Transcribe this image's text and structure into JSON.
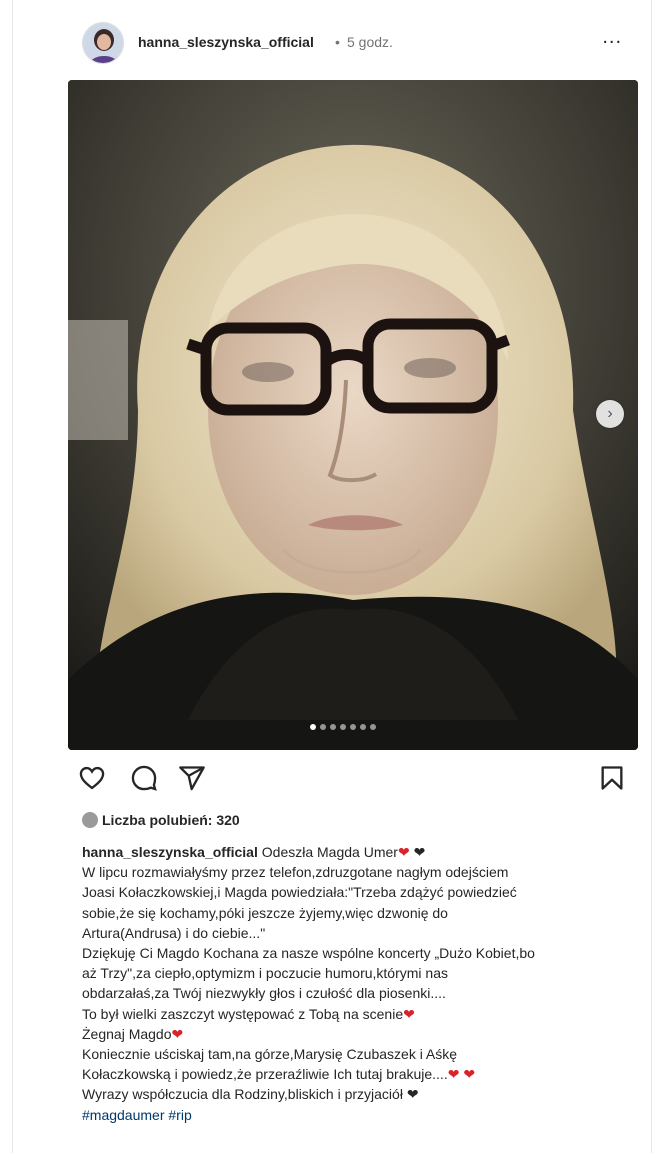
{
  "post": {
    "username": "hanna_sleszynska_official",
    "separator": "•",
    "time": "5 godz.",
    "more_label": "...",
    "carousel": {
      "current": 1,
      "total": 7,
      "next_label": "›"
    }
  },
  "likes": {
    "label": "Liczba polubień: 320"
  },
  "caption": {
    "username": "hanna_sleszynska_official",
    "first_text": "Odeszła Magda Umer",
    "lines": [
      "W lipcu rozmawiałyśmy przez telefon,zdruzgotane nagłym odejściem",
      "Joasi Kołaczkowskiej,i Magda powiedziała:\"Trzeba zdążyć powiedzieć",
      "sobie,że się kochamy,póki jeszcze żyjemy,więc dzwonię do",
      "Artura(Andrusa) i do ciebie...\"",
      "Dziękuję Ci Magdo Kochana za nasze wspólne koncerty „Dużo Kobiet,bo",
      "aż Trzy\",za ciepło,optymizm i poczucie humoru,którymi nas",
      "obdarzałaś,za Twój niezwykły głos i czułość dla piosenki....",
      "To był wielki zaszczyt występować z Tobą na scenie",
      "Żegnaj Magdo",
      "Koniecznie uściskaj tam,na górze,Marysię Czubaszek i Aśkę",
      "Kołaczkowską i powiedz,że przeraźliwie Ich tutaj brakuje....",
      "Wyrazy współczucia dla Rodziny,bliskich i przyjaciół"
    ],
    "hashtags": "#magdaumer #rip"
  },
  "emoji": {
    "red_heart": "❤",
    "black_heart": "❤"
  },
  "icons": [
    "heart-icon",
    "comment-icon",
    "share-icon",
    "bookmark-icon",
    "chevron-right-icon",
    "more-icon"
  ]
}
